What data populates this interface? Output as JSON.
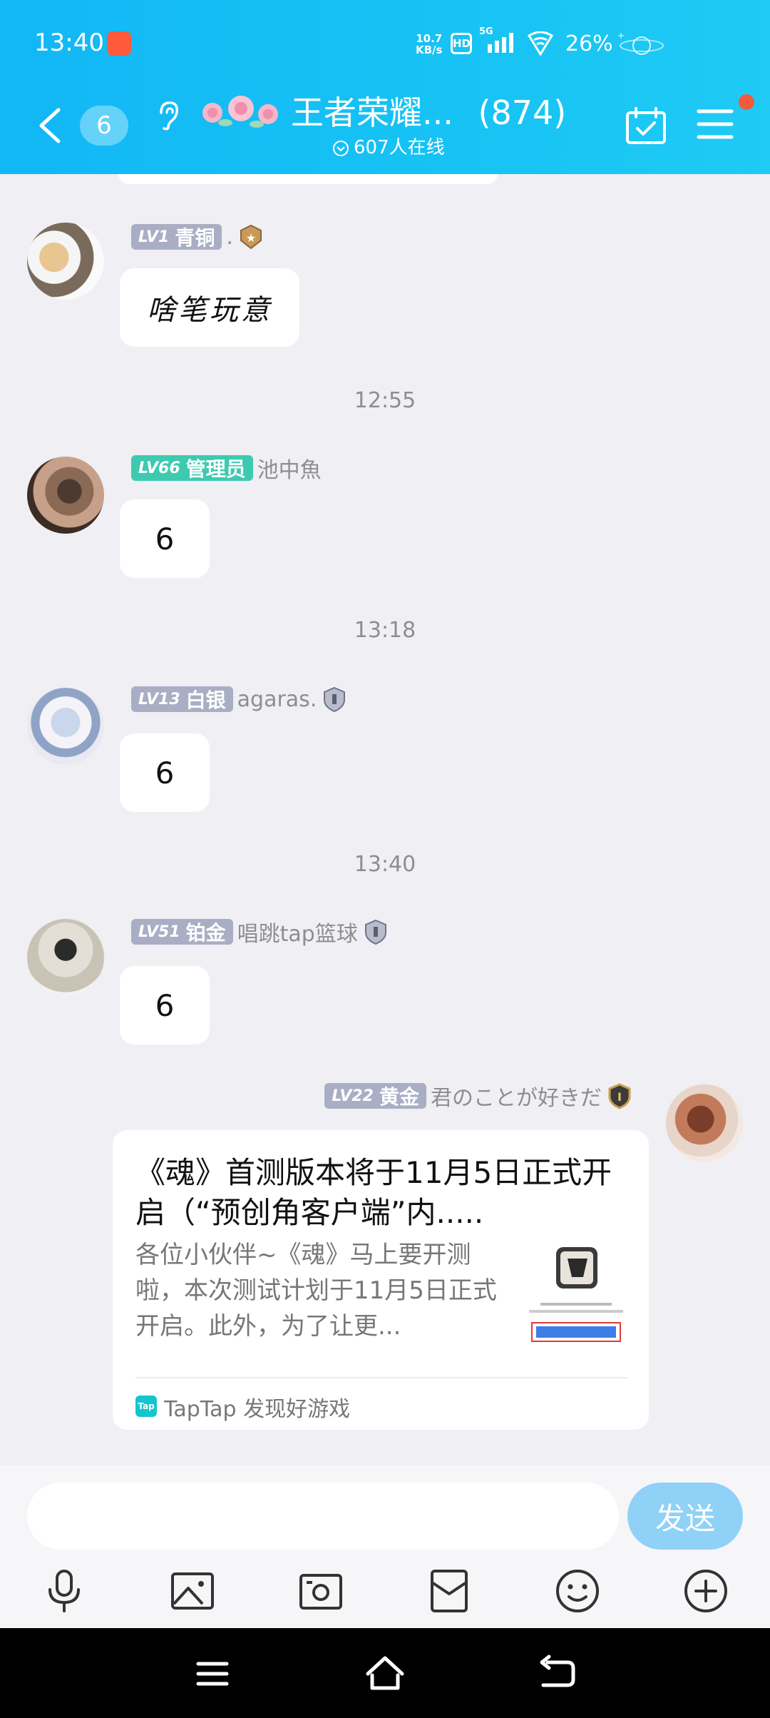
{
  "status_bar": {
    "time": "13:40",
    "net_speed_value": "10.7",
    "net_speed_unit": "KB/s",
    "hd": "HD",
    "signal": "5G",
    "battery": "26%"
  },
  "nav": {
    "back_count": "6",
    "title": "王者荣耀...",
    "member_count": "(874)",
    "online": "607人在线"
  },
  "messages": [
    {
      "level": "LV1",
      "rank": "青铜",
      "name": ".",
      "text": "啥笔玩意"
    },
    {
      "level": "LV66",
      "rank": "管理员",
      "name": "池中魚",
      "text": "6"
    },
    {
      "level": "LV13",
      "rank": "白银",
      "name": "agaras.",
      "text": "6"
    },
    {
      "level": "LV51",
      "rank": "铂金",
      "name": "唱跳tap篮球",
      "text": "6"
    },
    {
      "level": "LV22",
      "rank": "黄金",
      "name": "君のことが好きだ"
    }
  ],
  "timestamps": [
    "12:55",
    "13:18",
    "13:40"
  ],
  "share_card": {
    "title": "《魂》首测版本将于11月5日正式开启（“预创角客户端”内.....",
    "description": "各位小伙伴~《魂》马上要开测啦，本次测试计划于11月5日正式开启。此外，为了让更...",
    "source_icon": "Tap",
    "source": "TapTap 发现好游戏"
  },
  "input": {
    "placeholder": "",
    "send_label": "发送"
  },
  "colors": {
    "header": "#12b7f5",
    "send_button": "#8fd1f7",
    "admin_badge": "#3ecab1",
    "level_badge": "#a9aec4"
  },
  "icons": [
    "back-arrow-icon",
    "ear-icon",
    "calendar-check-icon",
    "menu-icon",
    "microphone-icon",
    "image-icon",
    "camera-icon",
    "red-packet-icon",
    "emoji-icon",
    "plus-icon",
    "home-icon",
    "recent-apps-icon",
    "back-icon"
  ]
}
